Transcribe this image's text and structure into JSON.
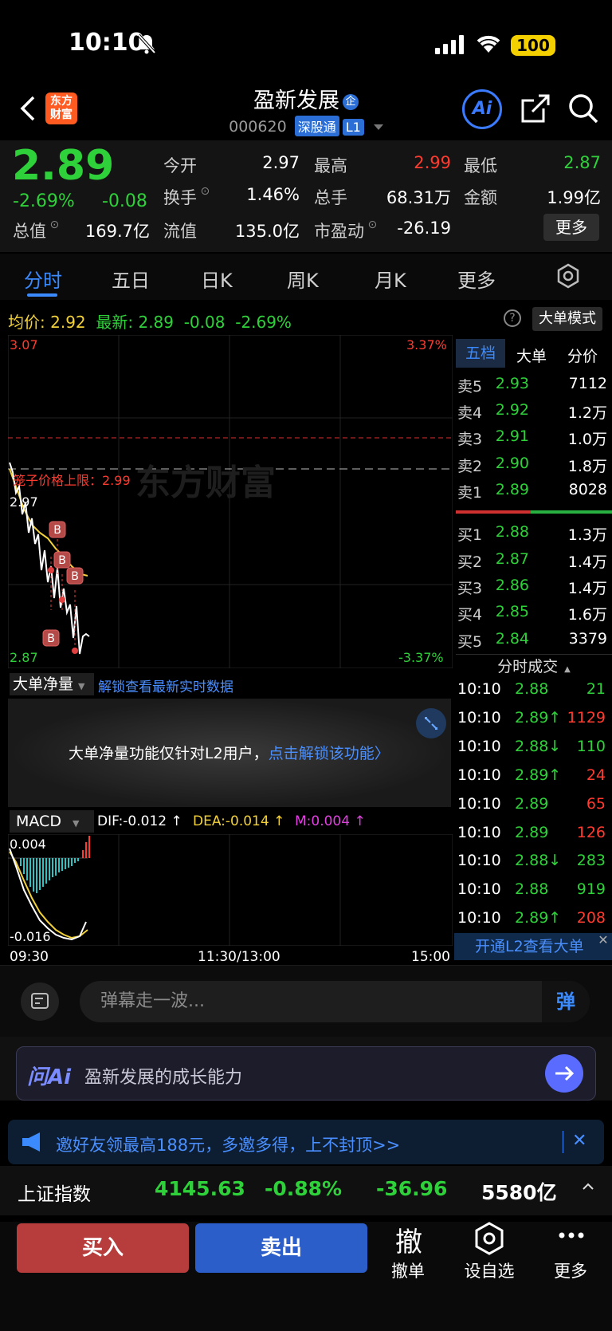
{
  "status": {
    "time": "10:10",
    "battery": "100"
  },
  "header": {
    "logo": "东方\n财富",
    "title": "盈新发展",
    "code": "000620",
    "tag_connect": "深股通",
    "tag_level": "L1"
  },
  "quote": {
    "last": "2.89",
    "change_pct": "-2.69%",
    "change": "-0.08",
    "fields": [
      {
        "label": "今开",
        "value": "2.97",
        "color": "#ffffff"
      },
      {
        "label": "最高",
        "value": "2.99",
        "color": "#ff3b30"
      },
      {
        "label": "最低",
        "value": "2.87",
        "color": "#2fd13a"
      },
      {
        "label": "换手",
        "value": "1.46%",
        "color": "#ffffff"
      },
      {
        "label": "总手",
        "value": "68.31万",
        "color": "#ffffff"
      },
      {
        "label": "金额",
        "value": "1.99亿",
        "color": "#ffffff"
      },
      {
        "label": "总值",
        "value": "169.7亿",
        "color": "#ffffff"
      },
      {
        "label": "流值",
        "value": "135.0亿",
        "color": "#ffffff"
      },
      {
        "label": "市盈动",
        "value": "-26.19",
        "color": "#ffffff"
      }
    ],
    "more": "更多"
  },
  "tabs": [
    "分时",
    "五日",
    "日K",
    "周K",
    "月K",
    "更多"
  ],
  "info": {
    "avg_label": "均价:",
    "avg": "2.92",
    "latest_label": "最新:",
    "latest": "2.89",
    "chg": "-0.08",
    "chg_pct": "-2.69%",
    "big_mode": "大单模式"
  },
  "chart": {
    "y_top": "3.07",
    "y_top_pct": "3.37%",
    "y_bot": "2.87",
    "y_bot_pct": "-3.37%",
    "mid": "2.97",
    "cage_label": "笼子价格上限：2.99",
    "watermark": "东方财富",
    "signal": "B"
  },
  "net_panel": {
    "dropdown": "大单净量",
    "unlock_link": "解锁查看最新实时数据",
    "notice": "大单净量功能仅针对L2用户，",
    "notice_link": "点击解锁该功能"
  },
  "macd": {
    "dropdown": "MACD",
    "dif": "DIF:-0.012 ↑",
    "dea": "DEA:-0.014 ↑",
    "m": "M:0.004 ↑",
    "top": "0.004",
    "bot": "-0.016",
    "x_start": "09:30",
    "x_mid": "11:30/13:00",
    "x_end": "15:00"
  },
  "orderbook": {
    "tabs": [
      "五档",
      "大单",
      "分价"
    ],
    "asks": [
      {
        "label": "卖5",
        "price": "2.93",
        "vol": "7112"
      },
      {
        "label": "卖4",
        "price": "2.92",
        "vol": "1.2万"
      },
      {
        "label": "卖3",
        "price": "2.91",
        "vol": "1.0万"
      },
      {
        "label": "卖2",
        "price": "2.90",
        "vol": "1.8万"
      },
      {
        "label": "卖1",
        "price": "2.89",
        "vol": "8028"
      }
    ],
    "bids": [
      {
        "label": "买1",
        "price": "2.88",
        "vol": "1.3万"
      },
      {
        "label": "买2",
        "price": "2.87",
        "vol": "1.4万"
      },
      {
        "label": "买3",
        "price": "2.86",
        "vol": "1.4万"
      },
      {
        "label": "买4",
        "price": "2.85",
        "vol": "1.6万"
      },
      {
        "label": "买5",
        "price": "2.84",
        "vol": "3379"
      }
    ],
    "trades_title": "分时成交",
    "trades": [
      {
        "time": "10:10",
        "price": "2.88",
        "vol": "21",
        "vcolor": "#2fd13a"
      },
      {
        "time": "10:10",
        "price": "2.89↑",
        "vol": "1129",
        "vcolor": "#ff3b30"
      },
      {
        "time": "10:10",
        "price": "2.88↓",
        "vol": "110",
        "vcolor": "#2fd13a"
      },
      {
        "time": "10:10",
        "price": "2.89↑",
        "vol": "24",
        "vcolor": "#ff3b30"
      },
      {
        "time": "10:10",
        "price": "2.89",
        "vol": "65",
        "vcolor": "#ff3b30"
      },
      {
        "time": "10:10",
        "price": "2.89",
        "vol": "126",
        "vcolor": "#ff3b30"
      },
      {
        "time": "10:10",
        "price": "2.88↓",
        "vol": "283",
        "vcolor": "#2fd13a"
      },
      {
        "time": "10:10",
        "price": "2.88",
        "vol": "919",
        "vcolor": "#2fd13a"
      },
      {
        "time": "10:10",
        "price": "2.89↑",
        "vol": "208",
        "vcolor": "#ff3b30"
      }
    ],
    "l2_banner": "开通L2查看大单"
  },
  "danmu": {
    "placeholder": "弹幕走一波...",
    "btn": "弹"
  },
  "ai": {
    "logo": "问Ai",
    "prompt": "盈新发展的成长能力"
  },
  "promo": {
    "text": "邀好友领最高188元，多邀多得，上不封顶>>"
  },
  "index_bar": {
    "name": "上证指数",
    "value": "4145.63",
    "pct": "-0.88%",
    "chg": "-36.96",
    "amount": "5580亿"
  },
  "actions": {
    "buy": "买入",
    "sell": "卖出",
    "cancel_glyph": "撤",
    "cancel": "撤单",
    "watch": "设自选",
    "more": "更多"
  }
}
